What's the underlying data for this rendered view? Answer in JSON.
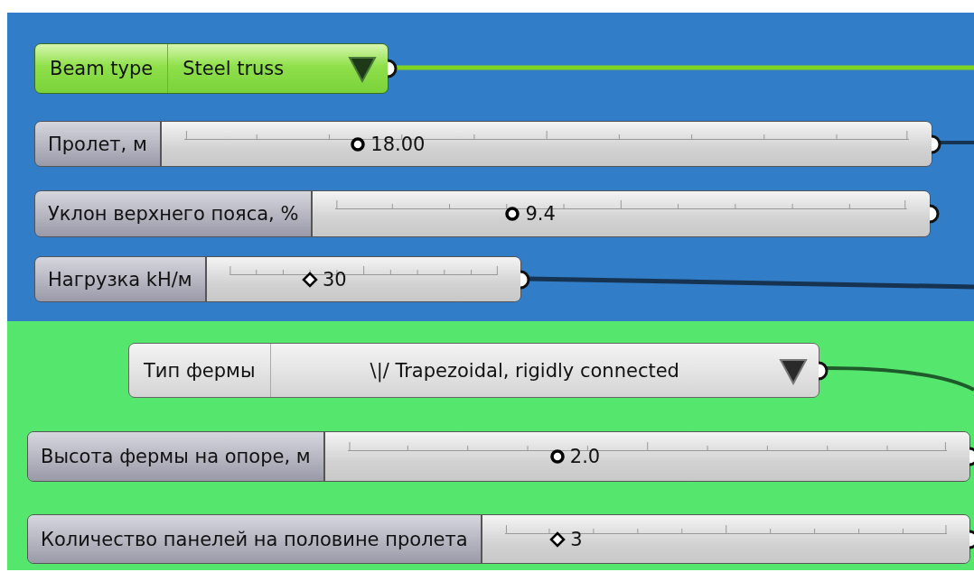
{
  "groups": [
    {
      "color": "#327dc8",
      "nodes": [
        {
          "kind": "value_list",
          "label": "Beam type",
          "value": "Steel truss",
          "selected": true
        },
        {
          "kind": "slider",
          "label": "Пролет, м",
          "value": "18.00",
          "grip": {
            "kind": "circle"
          },
          "level": 0.24
        },
        {
          "kind": "slider",
          "label": "Уклон верхнего пояса, %",
          "value": "9.4",
          "grip": {
            "kind": "circle"
          },
          "level": 0.31
        },
        {
          "kind": "slider",
          "label": "Нагрузка kH/м",
          "value": "30",
          "grip": {
            "kind": "diamond"
          },
          "level": 0.3
        }
      ]
    },
    {
      "color": "#55e66e",
      "nodes": [
        {
          "kind": "value_list",
          "label": "Тип фермы",
          "value": "\\|/ Trapezoidal, rigidly connected",
          "selected": false
        },
        {
          "kind": "slider",
          "label": "Высота фермы на опоре, м",
          "value": "2.0",
          "grip": {
            "kind": "circle"
          },
          "level": 0.35
        },
        {
          "kind": "slider",
          "label": "Количество панелей на половине пролета",
          "value": "3",
          "grip": {
            "kind": "diamond"
          },
          "level": 0.12
        }
      ]
    }
  ]
}
